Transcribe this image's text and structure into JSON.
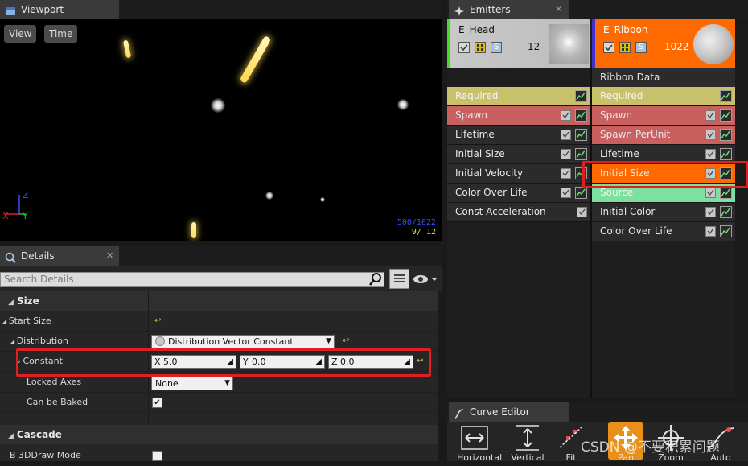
{
  "viewport": {
    "tab_title": "Viewport",
    "view_button": "View",
    "time_button": "Time",
    "axis_z": "Z",
    "axis_y": "Y",
    "axis_x": "X",
    "particle_count_total": "500/1022",
    "particle_count_head": "9/ 12"
  },
  "details": {
    "tab_title": "Details",
    "search_placeholder": "Search Details",
    "categories": {
      "size": "Size",
      "cascade": "Cascade"
    },
    "start_size_label": "Start Size",
    "distribution_label": "Distribution",
    "distribution_value": "Distribution Vector Constant",
    "constant_label": "Constant",
    "constant": {
      "x": "5.0",
      "y": "0.0",
      "z": "0.0",
      "x_axis": "X",
      "y_axis": "Y",
      "z_axis": "Z"
    },
    "locked_axes_label": "Locked Axes",
    "locked_axes_value": "None",
    "can_be_baked_label": "Can be Baked",
    "can_be_baked_checked": true,
    "b3d_draw_mode_label": "B 3DDraw Mode"
  },
  "emitters": {
    "tab_title": "Emitters",
    "head": {
      "name": "E_Head",
      "count": "12",
      "s_badge": "S",
      "accent": "#44dd22",
      "modules": [
        {
          "label": "Required",
          "color": "#c8c06a"
        },
        {
          "label": "Spawn",
          "color": "#c86060"
        },
        {
          "label": "Lifetime",
          "color": "#2b2b2b"
        },
        {
          "label": "Initial Size",
          "color": "#2b2b2b"
        },
        {
          "label": "Initial Velocity",
          "color": "#2b2b2b"
        },
        {
          "label": "Color Over Life",
          "color": "#2b2b2b"
        },
        {
          "label": "Const Acceleration",
          "color": "#2b2b2b"
        }
      ]
    },
    "ribbon": {
      "name": "E_Ribbon",
      "count": "1022",
      "s_badge": "S",
      "accent": "#4030d0",
      "type_data": "Ribbon Data",
      "modules": [
        {
          "label": "Required",
          "color": "#c8c06a"
        },
        {
          "label": "Spawn",
          "color": "#c86060"
        },
        {
          "label": "Spawn PerUnit",
          "color": "#c86060"
        },
        {
          "label": "Lifetime",
          "color": "#2b2b2b"
        },
        {
          "label": "Initial Size",
          "color": "#ff6a00"
        },
        {
          "label": "Source",
          "color": "#7ee0a0"
        },
        {
          "label": "Initial Color",
          "color": "#2b2b2b"
        },
        {
          "label": "Color Over Life",
          "color": "#2b2b2b"
        }
      ]
    }
  },
  "curve_editor": {
    "tab_title": "Curve Editor",
    "buttons": [
      "Horizontal",
      "Vertical",
      "Fit",
      "Pan",
      "Zoom",
      "Auto"
    ]
  },
  "watermark": "CSDN @不要积累问题"
}
